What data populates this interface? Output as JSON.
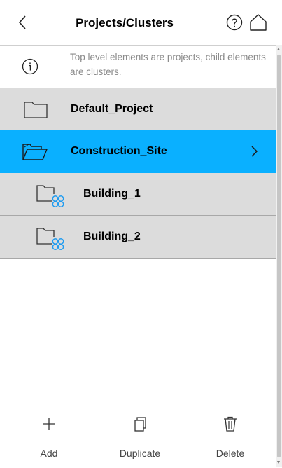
{
  "header": {
    "title": "Projects/Clusters",
    "back_icon": "chevron-left-icon",
    "help_icon": "help-circle-icon",
    "home_icon": "home-icon"
  },
  "info": {
    "icon": "info-circle-icon",
    "text": "Top level elements are projects, child elements are clusters."
  },
  "items": [
    {
      "label": "Default_Project",
      "type": "project",
      "icon": "folder-icon",
      "selected": false
    },
    {
      "label": "Construction_Site",
      "type": "project",
      "icon": "folder-open-icon",
      "selected": true
    },
    {
      "label": "Building_1",
      "type": "cluster",
      "icon": "cluster-folder-icon",
      "selected": false
    },
    {
      "label": "Building_2",
      "type": "cluster",
      "icon": "cluster-folder-icon",
      "selected": false
    }
  ],
  "toolbar": {
    "add_label": "Add",
    "duplicate_label": "Duplicate",
    "delete_label": "Delete"
  },
  "colors": {
    "selected_row": "#0ab0ff",
    "row_background": "#dcdcdc",
    "cluster_accent": "#1e9bf0",
    "info_text": "#8a8a8a"
  }
}
